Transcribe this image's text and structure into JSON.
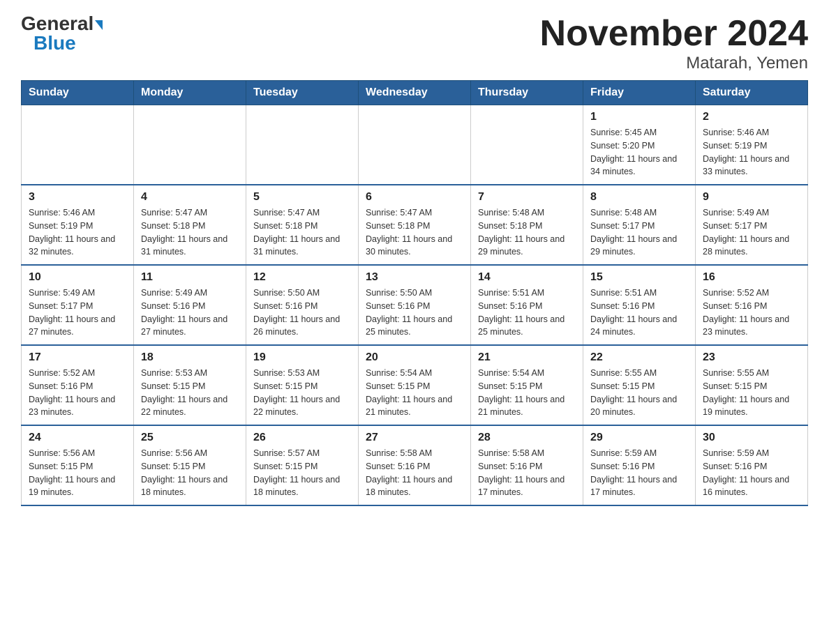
{
  "logo": {
    "general": "General",
    "blue": "Blue",
    "triangle": "▼"
  },
  "title": "November 2024",
  "subtitle": "Matarah, Yemen",
  "weekdays": [
    "Sunday",
    "Monday",
    "Tuesday",
    "Wednesday",
    "Thursday",
    "Friday",
    "Saturday"
  ],
  "weeks": [
    [
      {
        "day": "",
        "sunrise": "",
        "sunset": "",
        "daylight": ""
      },
      {
        "day": "",
        "sunrise": "",
        "sunset": "",
        "daylight": ""
      },
      {
        "day": "",
        "sunrise": "",
        "sunset": "",
        "daylight": ""
      },
      {
        "day": "",
        "sunrise": "",
        "sunset": "",
        "daylight": ""
      },
      {
        "day": "",
        "sunrise": "",
        "sunset": "",
        "daylight": ""
      },
      {
        "day": "1",
        "sunrise": "Sunrise: 5:45 AM",
        "sunset": "Sunset: 5:20 PM",
        "daylight": "Daylight: 11 hours and 34 minutes."
      },
      {
        "day": "2",
        "sunrise": "Sunrise: 5:46 AM",
        "sunset": "Sunset: 5:19 PM",
        "daylight": "Daylight: 11 hours and 33 minutes."
      }
    ],
    [
      {
        "day": "3",
        "sunrise": "Sunrise: 5:46 AM",
        "sunset": "Sunset: 5:19 PM",
        "daylight": "Daylight: 11 hours and 32 minutes."
      },
      {
        "day": "4",
        "sunrise": "Sunrise: 5:47 AM",
        "sunset": "Sunset: 5:18 PM",
        "daylight": "Daylight: 11 hours and 31 minutes."
      },
      {
        "day": "5",
        "sunrise": "Sunrise: 5:47 AM",
        "sunset": "Sunset: 5:18 PM",
        "daylight": "Daylight: 11 hours and 31 minutes."
      },
      {
        "day": "6",
        "sunrise": "Sunrise: 5:47 AM",
        "sunset": "Sunset: 5:18 PM",
        "daylight": "Daylight: 11 hours and 30 minutes."
      },
      {
        "day": "7",
        "sunrise": "Sunrise: 5:48 AM",
        "sunset": "Sunset: 5:18 PM",
        "daylight": "Daylight: 11 hours and 29 minutes."
      },
      {
        "day": "8",
        "sunrise": "Sunrise: 5:48 AM",
        "sunset": "Sunset: 5:17 PM",
        "daylight": "Daylight: 11 hours and 29 minutes."
      },
      {
        "day": "9",
        "sunrise": "Sunrise: 5:49 AM",
        "sunset": "Sunset: 5:17 PM",
        "daylight": "Daylight: 11 hours and 28 minutes."
      }
    ],
    [
      {
        "day": "10",
        "sunrise": "Sunrise: 5:49 AM",
        "sunset": "Sunset: 5:17 PM",
        "daylight": "Daylight: 11 hours and 27 minutes."
      },
      {
        "day": "11",
        "sunrise": "Sunrise: 5:49 AM",
        "sunset": "Sunset: 5:16 PM",
        "daylight": "Daylight: 11 hours and 27 minutes."
      },
      {
        "day": "12",
        "sunrise": "Sunrise: 5:50 AM",
        "sunset": "Sunset: 5:16 PM",
        "daylight": "Daylight: 11 hours and 26 minutes."
      },
      {
        "day": "13",
        "sunrise": "Sunrise: 5:50 AM",
        "sunset": "Sunset: 5:16 PM",
        "daylight": "Daylight: 11 hours and 25 minutes."
      },
      {
        "day": "14",
        "sunrise": "Sunrise: 5:51 AM",
        "sunset": "Sunset: 5:16 PM",
        "daylight": "Daylight: 11 hours and 25 minutes."
      },
      {
        "day": "15",
        "sunrise": "Sunrise: 5:51 AM",
        "sunset": "Sunset: 5:16 PM",
        "daylight": "Daylight: 11 hours and 24 minutes."
      },
      {
        "day": "16",
        "sunrise": "Sunrise: 5:52 AM",
        "sunset": "Sunset: 5:16 PM",
        "daylight": "Daylight: 11 hours and 23 minutes."
      }
    ],
    [
      {
        "day": "17",
        "sunrise": "Sunrise: 5:52 AM",
        "sunset": "Sunset: 5:16 PM",
        "daylight": "Daylight: 11 hours and 23 minutes."
      },
      {
        "day": "18",
        "sunrise": "Sunrise: 5:53 AM",
        "sunset": "Sunset: 5:15 PM",
        "daylight": "Daylight: 11 hours and 22 minutes."
      },
      {
        "day": "19",
        "sunrise": "Sunrise: 5:53 AM",
        "sunset": "Sunset: 5:15 PM",
        "daylight": "Daylight: 11 hours and 22 minutes."
      },
      {
        "day": "20",
        "sunrise": "Sunrise: 5:54 AM",
        "sunset": "Sunset: 5:15 PM",
        "daylight": "Daylight: 11 hours and 21 minutes."
      },
      {
        "day": "21",
        "sunrise": "Sunrise: 5:54 AM",
        "sunset": "Sunset: 5:15 PM",
        "daylight": "Daylight: 11 hours and 21 minutes."
      },
      {
        "day": "22",
        "sunrise": "Sunrise: 5:55 AM",
        "sunset": "Sunset: 5:15 PM",
        "daylight": "Daylight: 11 hours and 20 minutes."
      },
      {
        "day": "23",
        "sunrise": "Sunrise: 5:55 AM",
        "sunset": "Sunset: 5:15 PM",
        "daylight": "Daylight: 11 hours and 19 minutes."
      }
    ],
    [
      {
        "day": "24",
        "sunrise": "Sunrise: 5:56 AM",
        "sunset": "Sunset: 5:15 PM",
        "daylight": "Daylight: 11 hours and 19 minutes."
      },
      {
        "day": "25",
        "sunrise": "Sunrise: 5:56 AM",
        "sunset": "Sunset: 5:15 PM",
        "daylight": "Daylight: 11 hours and 18 minutes."
      },
      {
        "day": "26",
        "sunrise": "Sunrise: 5:57 AM",
        "sunset": "Sunset: 5:15 PM",
        "daylight": "Daylight: 11 hours and 18 minutes."
      },
      {
        "day": "27",
        "sunrise": "Sunrise: 5:58 AM",
        "sunset": "Sunset: 5:16 PM",
        "daylight": "Daylight: 11 hours and 18 minutes."
      },
      {
        "day": "28",
        "sunrise": "Sunrise: 5:58 AM",
        "sunset": "Sunset: 5:16 PM",
        "daylight": "Daylight: 11 hours and 17 minutes."
      },
      {
        "day": "29",
        "sunrise": "Sunrise: 5:59 AM",
        "sunset": "Sunset: 5:16 PM",
        "daylight": "Daylight: 11 hours and 17 minutes."
      },
      {
        "day": "30",
        "sunrise": "Sunrise: 5:59 AM",
        "sunset": "Sunset: 5:16 PM",
        "daylight": "Daylight: 11 hours and 16 minutes."
      }
    ]
  ]
}
